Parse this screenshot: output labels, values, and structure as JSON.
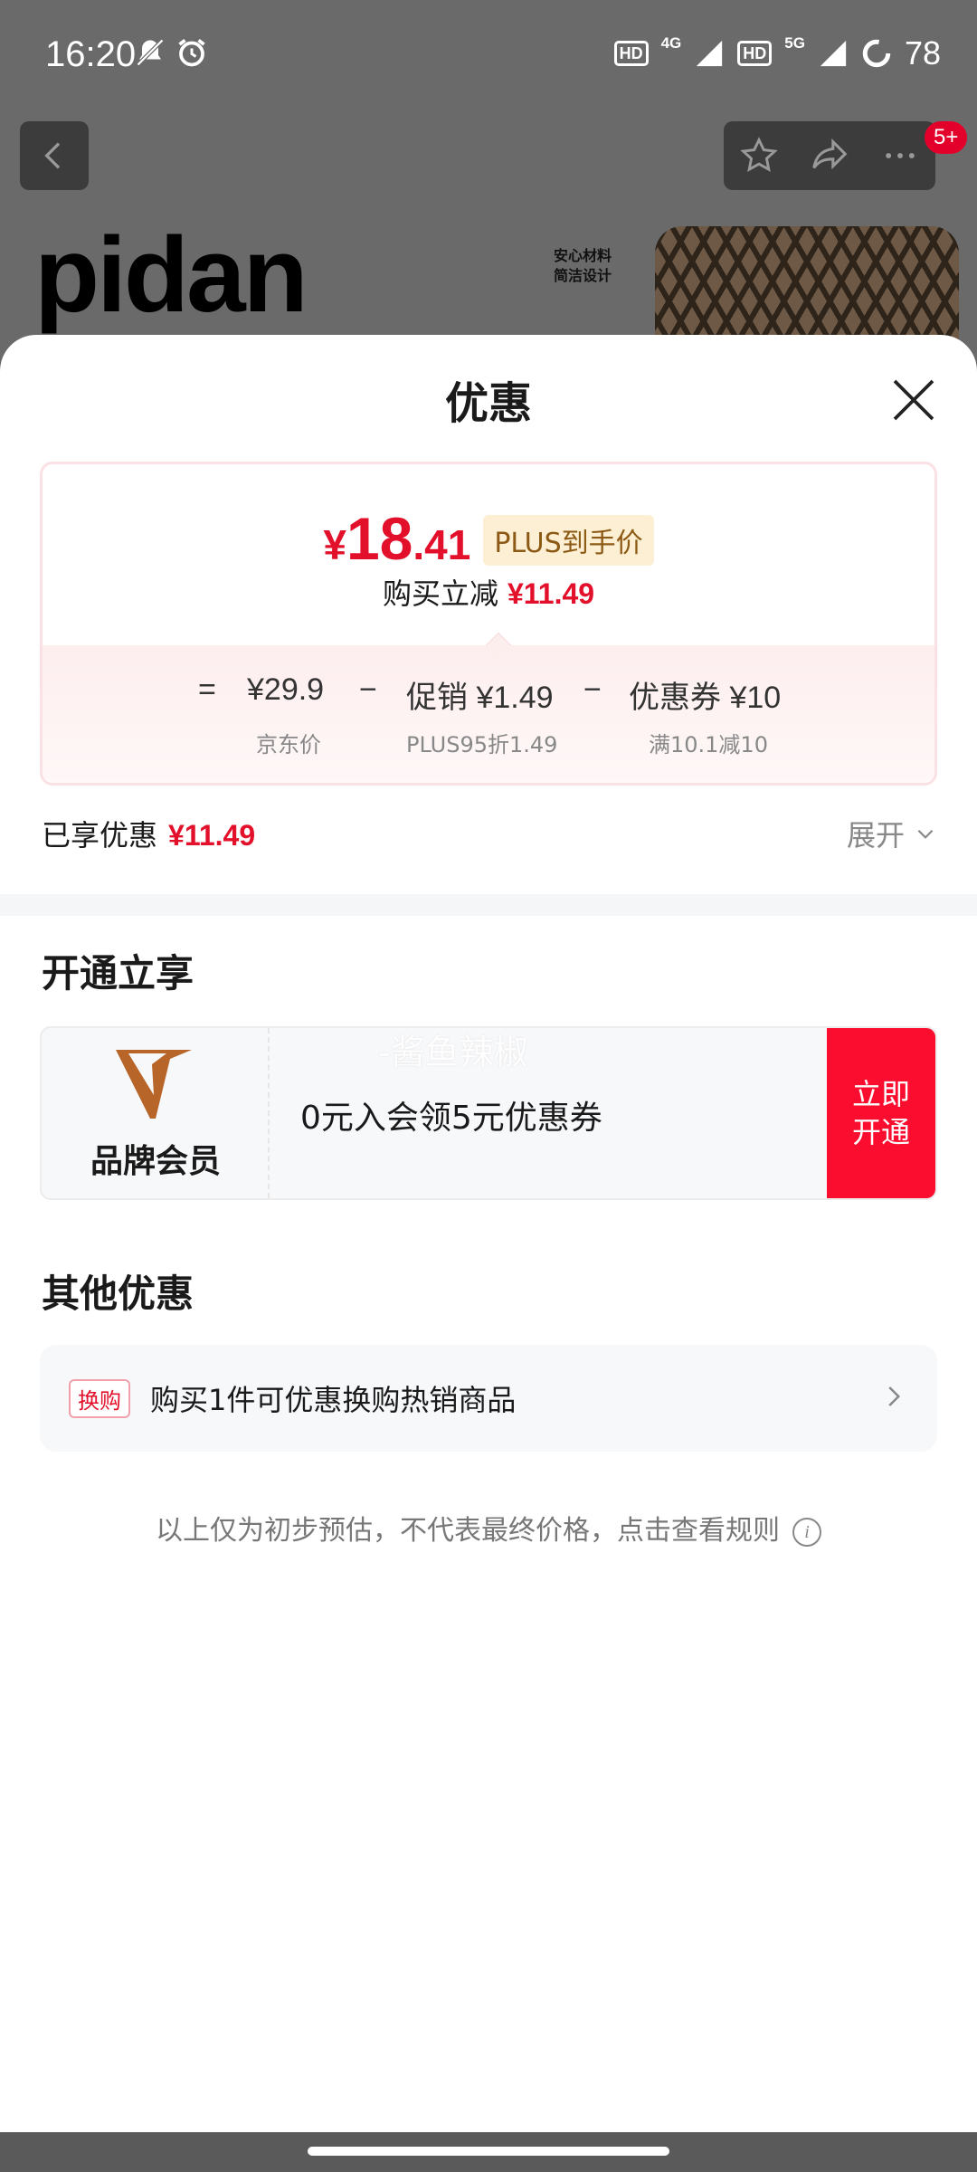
{
  "status_bar": {
    "time": "16:20",
    "battery": "78",
    "net_left": "4G",
    "net_right": "5G",
    "hd": "HD"
  },
  "background": {
    "badge": "5+",
    "brand_logo": "pidan",
    "brand_tag_line1": "安心材料",
    "brand_tag_line2": "简洁设计"
  },
  "sheet": {
    "title": "优惠",
    "price": {
      "currency": "¥",
      "integer": "18",
      "decimal": ".41",
      "tag": "PLUS到手价"
    },
    "reduce_label": "购买立减",
    "reduce_value": "¥11.49",
    "formula": {
      "eq": "=",
      "jd_price": "¥29.9",
      "minus1": "−",
      "promo": "促销 ¥1.49",
      "minus2": "−",
      "coupon": "优惠券 ¥10",
      "jd_label": "京东价",
      "promo_label": "PLUS95折1.49",
      "coupon_label": "满10.1减10"
    },
    "enjoyed_label": "已享优惠",
    "enjoyed_value": "¥11.49",
    "expand_label": "展开",
    "open_section_title": "开通立享",
    "member": {
      "name": "品牌会员",
      "desc": "0元入会领5元优惠券",
      "watermark": "-酱鱼辣椒",
      "btn_line1": "立即",
      "btn_line2": "开通",
      "logo_color": "#b8652a"
    },
    "other_section_title": "其他优惠",
    "swap": {
      "tag": "换购",
      "text": "购买1件可优惠换购热销商品"
    },
    "disclaimer": "以上仅为初步预估，不代表最终价格，点击查看规则",
    "info_symbol": "i"
  },
  "colors": {
    "accent_red": "#e3102b",
    "button_red": "#fa0d2e",
    "plus_gold": "#8c5a15"
  }
}
